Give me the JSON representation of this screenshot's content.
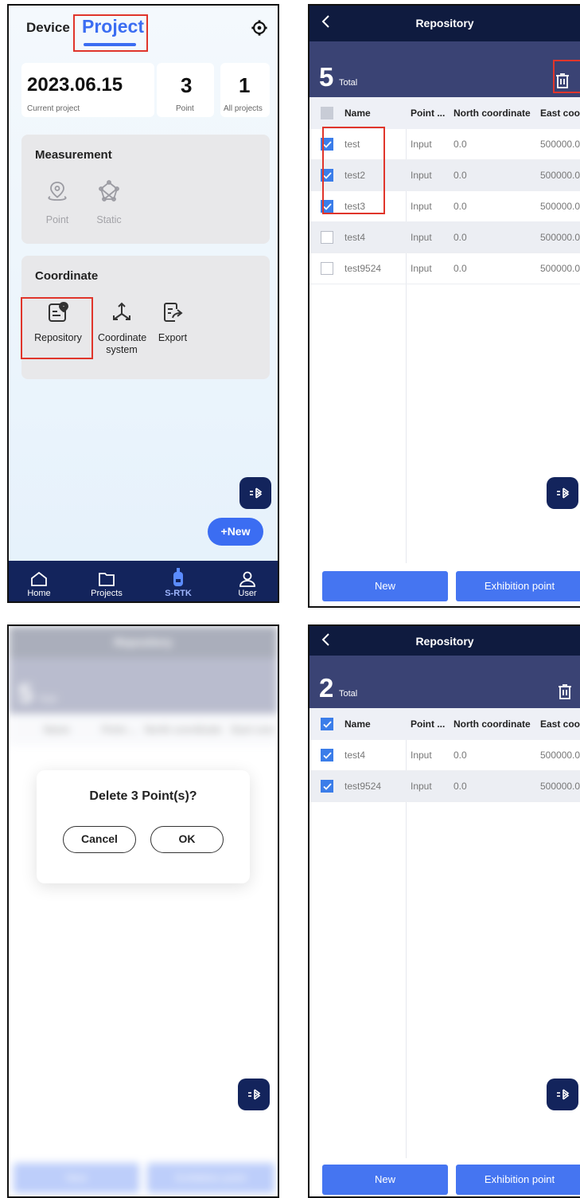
{
  "p1": {
    "tab_device": "Device",
    "tab_project": "Project",
    "stats": [
      {
        "value": "2023.06.15",
        "label": "Current project"
      },
      {
        "value": "3",
        "label": "Point"
      },
      {
        "value": "1",
        "label": "All projects"
      }
    ],
    "measurement": {
      "title": "Measurement",
      "tools": [
        "Point",
        "Static"
      ]
    },
    "coordinate": {
      "title": "Coordinate",
      "tools": [
        "Repository",
        "Coordinate system",
        "Export"
      ]
    },
    "new_label": "+New",
    "nav": [
      "Home",
      "Projects",
      "S-RTK",
      "User"
    ]
  },
  "repo_a": {
    "title": "Repository",
    "count": "5",
    "total_label": "Total",
    "headers": [
      "Name",
      "Point ...",
      "North coordinate",
      "East coor"
    ],
    "rows": [
      {
        "name": "test",
        "type": "Input",
        "north": "0.0",
        "east": "500000.0",
        "checked": true
      },
      {
        "name": "test2",
        "type": "Input",
        "north": "0.0",
        "east": "500000.0",
        "checked": true
      },
      {
        "name": "test3",
        "type": "Input",
        "north": "0.0",
        "east": "500000.0",
        "checked": true
      },
      {
        "name": "test4",
        "type": "Input",
        "north": "0.0",
        "east": "500000.0",
        "checked": false
      },
      {
        "name": "test9524",
        "type": "Input",
        "north": "0.0",
        "east": "500000.0",
        "checked": false
      }
    ],
    "btn_new": "New",
    "btn_exhibit": "Exhibition point"
  },
  "dialog": {
    "message": "Delete 3 Point(s)?",
    "cancel": "Cancel",
    "ok": "OK",
    "bg_title": "Repository",
    "bg_count": "5",
    "bg_total": "Total",
    "bg_headers": [
      "Name",
      "Point ...",
      "North coordinate",
      "East coor"
    ],
    "bg_btn_new": "New",
    "bg_btn_exhibit": "Exhibition point"
  },
  "repo_b": {
    "title": "Repository",
    "count": "2",
    "total_label": "Total",
    "headers": [
      "Name",
      "Point ...",
      "North coordinate",
      "East coo"
    ],
    "rows": [
      {
        "name": "test4",
        "type": "Input",
        "north": "0.0",
        "east": "500000.0",
        "checked": true
      },
      {
        "name": "test9524",
        "type": "Input",
        "north": "0.0",
        "east": "500000.0",
        "checked": true
      }
    ],
    "btn_new": "New",
    "btn_exhibit": "Exhibition point"
  },
  "colors": {
    "accent": "#3b6df2",
    "navy": "#13245c",
    "highlight": "#e0352b",
    "check": "#3b7de9"
  }
}
